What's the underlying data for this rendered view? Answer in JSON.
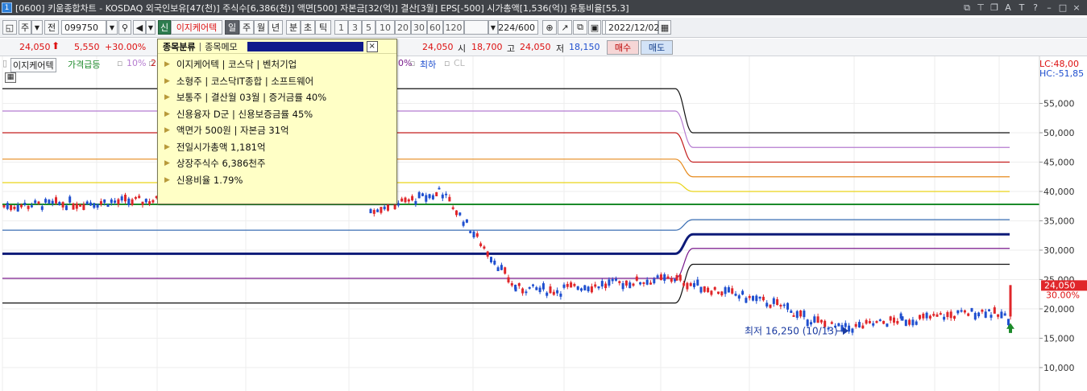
{
  "window": {
    "title": "[0600] 키움종합차트 - KOSDAQ 외국인보유[47(천)] 주식수[6,386(천)] 액면[500] 자본금[32(억)] 결산[3월] EPS[-500] 시가총액[1,536(억)] 유통비율[55.3]",
    "icon_label": "1"
  },
  "toolbar": {
    "period": "주",
    "prev_label": "전",
    "code": "099750",
    "badge_new": "신",
    "stock_name": "이지케어텍",
    "intervals": [
      "일",
      "주",
      "월",
      "년",
      "분",
      "초",
      "틱"
    ],
    "minutes": [
      "1",
      "3",
      "5",
      "10",
      "20",
      "30",
      "60",
      "120"
    ],
    "count": "224/600",
    "date": "2022/12/02"
  },
  "quote": {
    "price": "24,050",
    "change": "5,550",
    "change_pct": "+30.00%",
    "right_price": "24,050",
    "open_label": "시",
    "open": "18,700",
    "high_label": "고",
    "high": "24,050",
    "low_label": "저",
    "low": "18,150",
    "buy": "매수",
    "sell": "매도"
  },
  "legend": {
    "stock": "이지케어텍",
    "band": "가격급등",
    "pct10": "10%",
    "pct20": "2(",
    "pct_tail": "0%",
    "min_label": "최하",
    "cl": "CL"
  },
  "popup": {
    "tab_classify": "종목분류",
    "tab_memo": "종목메모",
    "close": "×",
    "items": [
      "이지케어텍 | 코스닥 | 벤처기업",
      "소형주 | 코스닥IT종합 | 소프트웨어",
      "보통주 | 결산월 03월 | 증거금률 40%",
      "신용융자 D군 | 신용보증금률 45%",
      "액면가 500원 | 자본금 31억",
      "전일시가총액 1,181억",
      "상장주식수 6,386천주",
      "신용비율 1.79%"
    ]
  },
  "chart_data": {
    "type": "candlestick",
    "title": "",
    "y_ticks": [
      "55,000",
      "50,000",
      "45,000",
      "40,000",
      "35,000",
      "30,000",
      "25,000",
      "20,000",
      "15,000",
      "10,000"
    ],
    "ylim": [
      5000,
      61500
    ],
    "lc_label": "LC:48,00",
    "hc_label": "HC:-51,85",
    "last_price_label": "24,050",
    "last_pct_label": "30.00%",
    "min_annotation": "최저 16,250 (10/13)",
    "colors": {
      "up": "#e0262a",
      "down": "#1f4fcf",
      "last_tag": "#e0262a"
    },
    "levels_left": [
      {
        "name": "black-upper",
        "value": 57500,
        "to": 50000,
        "color": "#111111"
      },
      {
        "name": "violet",
        "value": 53700,
        "to": 47500,
        "color": "#b57bd0"
      },
      {
        "name": "red",
        "value": 50000,
        "to": 45000,
        "color": "#c31d1d"
      },
      {
        "name": "orange",
        "value": 45500,
        "to": 42500,
        "color": "#e68a1c"
      },
      {
        "name": "yellow",
        "value": 41500,
        "to": 40000,
        "color": "#e9d419"
      },
      {
        "name": "green",
        "value": 37800,
        "to": 37800,
        "color": "#1c8a2a"
      },
      {
        "name": "steel",
        "value": 33400,
        "to": 35200,
        "color": "#3b6fb4"
      },
      {
        "name": "navy-thick",
        "value": 29400,
        "to": 32700,
        "color": "#0d1a78"
      },
      {
        "name": "purple",
        "value": 25200,
        "to": 30300,
        "color": "#7a1a8c"
      },
      {
        "name": "black-lower",
        "value": 21000,
        "to": 27600,
        "color": "#111111"
      }
    ]
  }
}
